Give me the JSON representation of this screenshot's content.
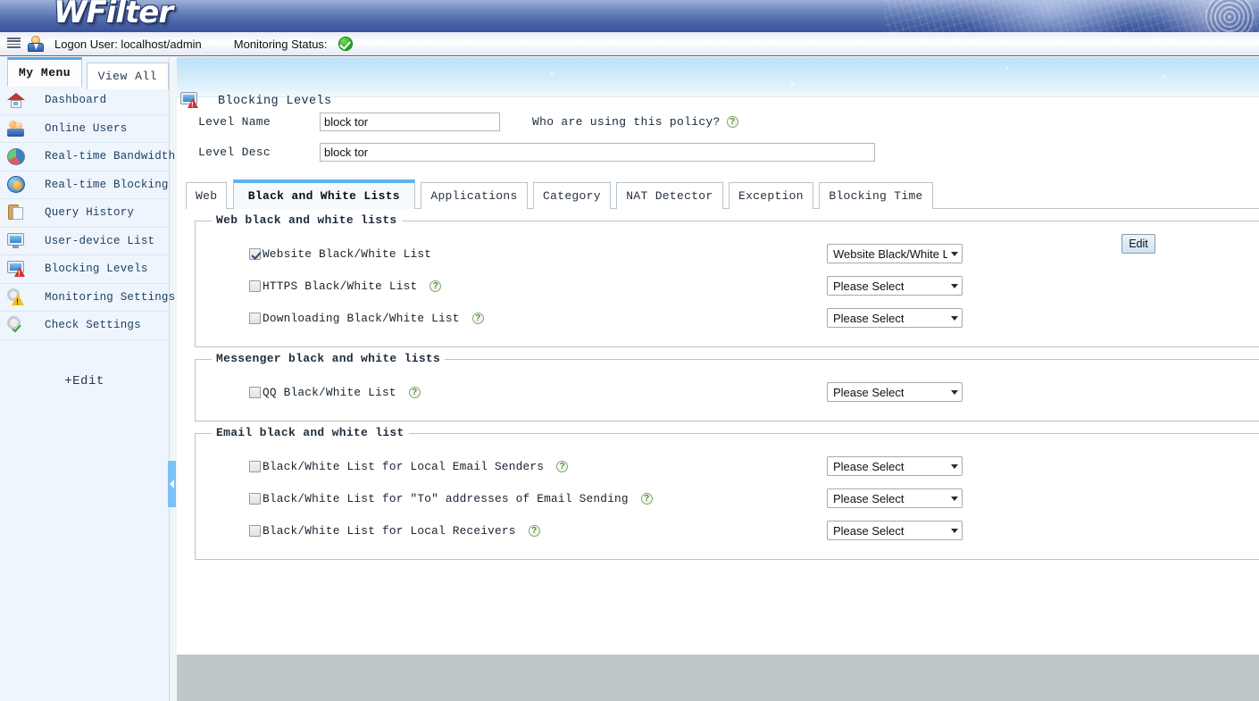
{
  "banner": {
    "logo": "WFilter"
  },
  "statusbar": {
    "list_icon": "list-icon",
    "user_icon": "user-avatar-icon",
    "logon_label": "Logon User: localhost/admin",
    "monitoring_label": "Monitoring Status:",
    "monitoring_status_icon": "green-check-icon"
  },
  "sidebar": {
    "tabs": [
      {
        "label": "My Menu",
        "active": true
      },
      {
        "label": "View All",
        "active": false
      }
    ],
    "items": [
      {
        "label": "Dashboard",
        "icon": "home-icon"
      },
      {
        "label": "Online Users",
        "icon": "users-icon"
      },
      {
        "label": "Real-time Bandwidth",
        "icon": "pie-chart-icon"
      },
      {
        "label": "Real-time Blocking",
        "icon": "globe-gear-icon"
      },
      {
        "label": "Query History",
        "icon": "clipboard-icon"
      },
      {
        "label": "User-device List",
        "icon": "monitor-icon"
      },
      {
        "label": "Blocking Levels",
        "icon": "monitor-warning-icon"
      },
      {
        "label": "Monitoring Settings",
        "icon": "gear-warning-icon"
      },
      {
        "label": "Check Settings",
        "icon": "gear-check-icon"
      }
    ],
    "edit_label": "+Edit",
    "collapse_handle": "collapse-sidebar-handle"
  },
  "page": {
    "title": "Blocking Levels",
    "title_icon": "monitor-warning-icon"
  },
  "form": {
    "level_name_label": "Level Name",
    "level_name_value": "block tor",
    "level_desc_label": "Level Desc",
    "level_desc_value": "block tor",
    "who_link": "Who are using this policy?",
    "who_help_icon": "help-icon"
  },
  "tabs": [
    {
      "label": "Web",
      "active": false
    },
    {
      "label": "Black and White Lists",
      "active": true
    },
    {
      "label": "Applications",
      "active": false
    },
    {
      "label": "Category",
      "active": false
    },
    {
      "label": "NAT Detector",
      "active": false
    },
    {
      "label": "Exception",
      "active": false
    },
    {
      "label": "Blocking Time",
      "active": false
    }
  ],
  "sections": [
    {
      "legend": "Web black and white lists",
      "rows": [
        {
          "label": "Website Black/White List",
          "checked": true,
          "help": false,
          "select_value": "Website Black/White L",
          "has_edit": true,
          "edit_label": "Edit"
        },
        {
          "label": "HTTPS Black/White List",
          "checked": false,
          "help": true,
          "select_value": "Please Select",
          "has_edit": false
        },
        {
          "label": "Downloading Black/White List",
          "checked": false,
          "help": true,
          "select_value": "Please Select",
          "has_edit": false
        }
      ]
    },
    {
      "legend": "Messenger black and white lists",
      "rows": [
        {
          "label": "QQ Black/White List",
          "checked": false,
          "help": true,
          "select_value": "Please Select",
          "has_edit": false
        }
      ]
    },
    {
      "legend": "Email black and white list",
      "rows": [
        {
          "label": "Black/White List for Local Email Senders",
          "checked": false,
          "help": true,
          "select_value": "Please Select",
          "has_edit": false
        },
        {
          "label": "Black/White List for \"To\" addresses of Email Sending",
          "checked": false,
          "help": true,
          "select_value": "Please Select",
          "has_edit": false
        },
        {
          "label": "Black/White List for Local Receivers",
          "checked": false,
          "help": true,
          "select_value": "Please Select",
          "has_edit": false
        }
      ]
    }
  ],
  "colors": {
    "banner_blue": "#4a64a8",
    "accent_tab_blue": "#5bb3ef",
    "status_green": "#1f9e1c",
    "footer_gray": "#bfc8c9",
    "sidebar_bg": "#eef5fc"
  }
}
